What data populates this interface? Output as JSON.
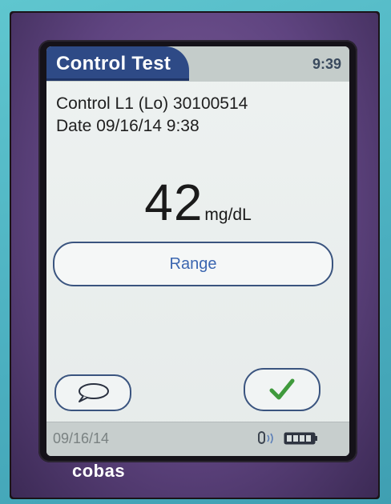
{
  "header": {
    "title": "Control Test",
    "time": "9:39"
  },
  "control": {
    "line1": "Control L1 (Lo) 30100514",
    "line2": "Date 09/16/14  9:38"
  },
  "result": {
    "value": "42",
    "unit": "mg/dL"
  },
  "buttons": {
    "range_label": "Range"
  },
  "status_bar": {
    "date": "09/16/14"
  },
  "branding": {
    "logo_text": "cobas"
  },
  "colors": {
    "title_tab": "#2e4a86",
    "button_border": "#3a547f",
    "range_text": "#3b66b0",
    "check_mark": "#3f9a3c",
    "device_body": "#5f4480"
  },
  "icons": [
    "comment-icon",
    "checkmark-icon",
    "microphone-icon",
    "battery-icon"
  ]
}
